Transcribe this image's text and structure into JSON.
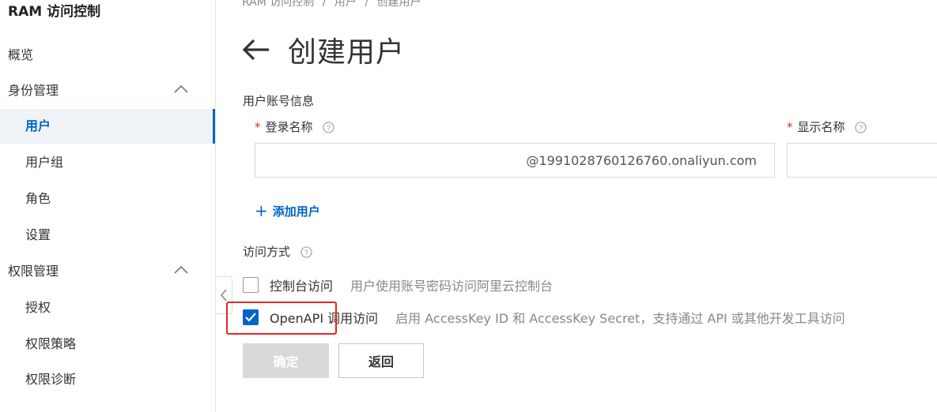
{
  "sidebar": {
    "app_title": "RAM 访问控制",
    "overview": "概览",
    "identity_group": "身份管理",
    "users": "用户",
    "user_groups": "用户组",
    "roles": "角色",
    "settings": "设置",
    "permission_group": "权限管理",
    "grants": "授权",
    "policies": "权限策略",
    "diagnosis": "权限诊断"
  },
  "breadcrumb": [
    "RAM 访问控制",
    "/",
    "用户",
    "/",
    "创建用户"
  ],
  "page": {
    "title": "创建用户",
    "account_section": "用户账号信息",
    "login_name_label": "登录名称",
    "login_name_suffix": "@1991028760126760.onaliyun.com",
    "display_name_label": "显示名称",
    "add_user": "添加用户",
    "access_section": "访问方式",
    "console_access": {
      "label": "控制台访问",
      "desc": "用户使用账号密码访问阿里云控制台",
      "checked": false
    },
    "openapi_access": {
      "label": "OpenAPI 调用访问",
      "desc": "启用 AccessKey ID 和 AccessKey Secret，支持通过 API 或其他开发工具访问",
      "checked": true
    },
    "confirm_button": "确定",
    "back_button": "返回"
  },
  "colors": {
    "accent": "#0064c8",
    "required": "#d93026",
    "highlight": "#e12828",
    "disabled_button": "#d9d9d9"
  }
}
